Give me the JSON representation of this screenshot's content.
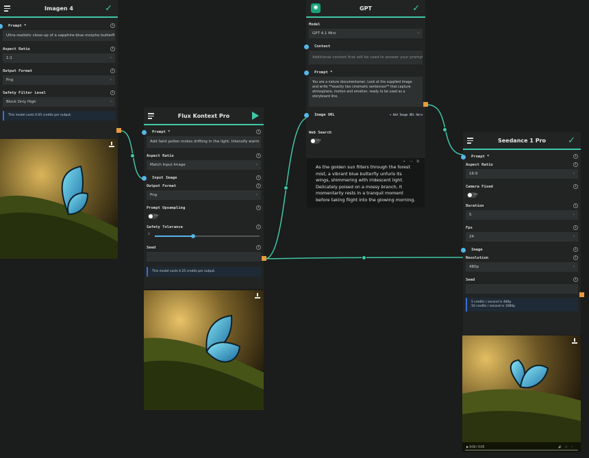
{
  "imagen": {
    "title": "Imagen 4",
    "prompt_label": "Prompt *",
    "prompt_value": "Ultra-realistic close-up of a sapphire-blue morpho butterfly",
    "aspect_label": "Aspect Ratio",
    "aspect_value": "1:1",
    "format_label": "Output Format",
    "format_value": "Png",
    "safety_label": "Safety Filter Level",
    "safety_value": "Block Only High",
    "cost_note": "This model costs 0.05 credits per output."
  },
  "flux": {
    "title": "Flux Kontext Pro",
    "prompt_label": "Prompt *",
    "prompt_value": "Add faint pollen motes drifting in the light. Intensify warm",
    "aspect_label": "Aspect Ratio",
    "aspect_value": "Match Input Image",
    "input_image_label": "Input Image",
    "format_label": "Output Format",
    "format_value": "Png",
    "upsampling_label": "Prompt Upsampling",
    "upsampling_state": "OFF",
    "tolerance_label": "Safety Tolerance",
    "tolerance_value": "2",
    "tolerance_level": 0.35,
    "seed_label": "Seed",
    "cost_note": "This model costs 4.25 credits per output."
  },
  "gpt": {
    "title": "GPT",
    "model_label": "Model",
    "model_value": "GPT 4.1 Mini",
    "context_label": "Context",
    "context_placeholder": "Additional context that will be used to answer your prompt",
    "prompt_label": "Prompt *",
    "prompt_value": "You are a nature documentarian. Look at the supplied image and write **exactly two cinematic sentences** that capture atmosphere, motion and emotion, ready to be used as a storyboard line.",
    "image_url_label": "Image URL",
    "add_url_label": "Add Image URL Here",
    "web_search_label": "Web Search",
    "web_search_state": "OFF",
    "output_text": "As the golden sun filters through the forest mist, a vibrant blue butterfly unfurls its wings, shimmering with iridescent light. Delicately poised on a mossy branch, it momentarily rests in a tranquil moment before taking flight into the glowing morning."
  },
  "seedance": {
    "title": "Seedance 1 Pro",
    "prompt_label": "Prompt *",
    "aspect_label": "Aspect Ratio",
    "aspect_value": "16:9",
    "camera_label": "Camera Fixed",
    "camera_state": "OFF",
    "duration_label": "Duration",
    "duration_value": "5",
    "fps_label": "Fps",
    "fps_value": "24",
    "image_label": "Image",
    "resolution_label": "Resolution",
    "resolution_value": "480p",
    "seed_label": "Seed",
    "cost_note_1": "5 credits / second in 480p",
    "cost_note_2": "10 credits / second in 1080p",
    "video_time": "0:04 / 0:05"
  },
  "colors": {
    "accent": "#3fc9a6",
    "port": "#e79a3c",
    "input_pin": "#56b6e9",
    "background": "#1b1c1c"
  }
}
